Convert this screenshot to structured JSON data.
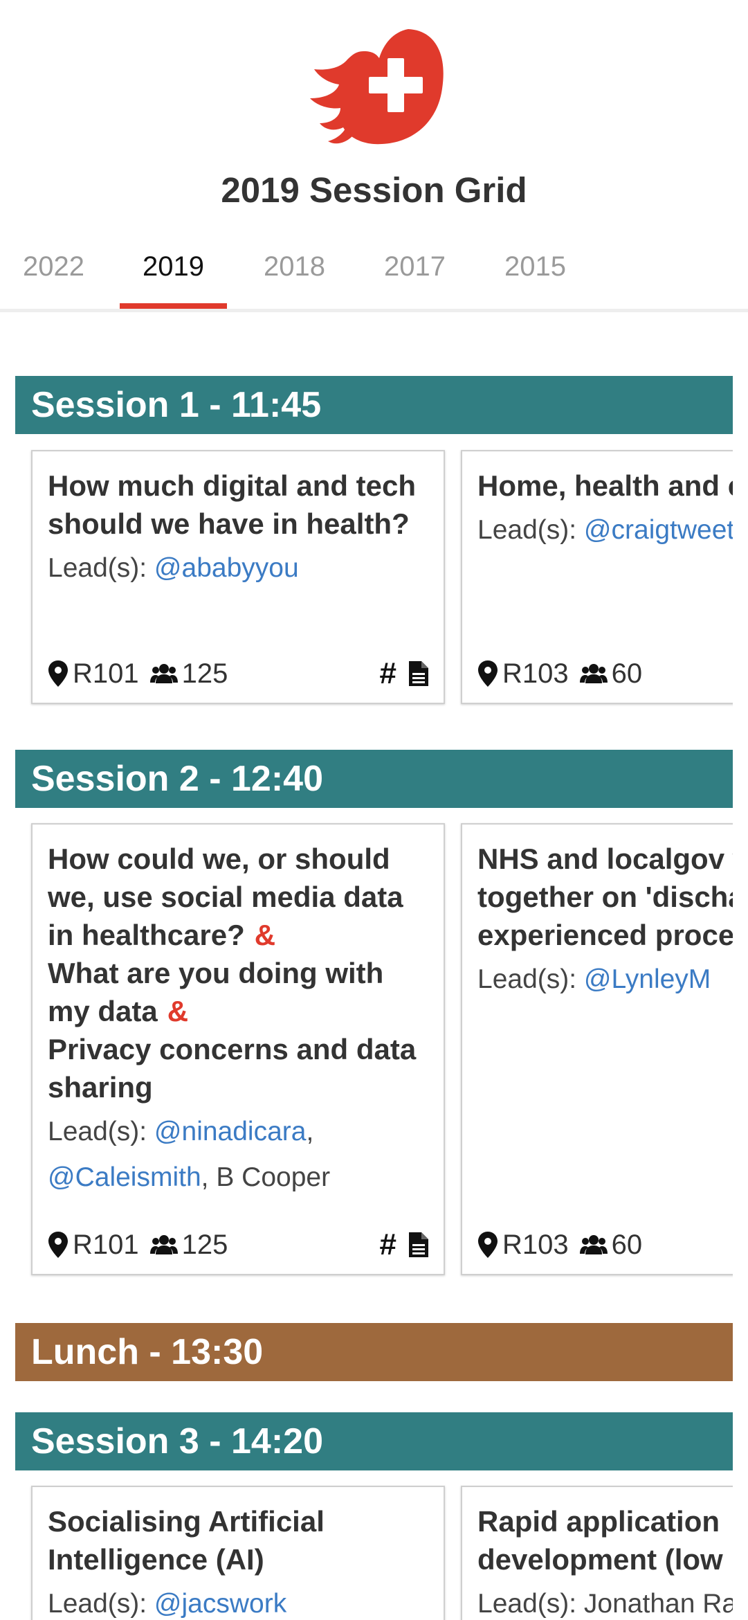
{
  "brand": {
    "logo_icon": "flame-cross-logo",
    "accent": "#e03a2c"
  },
  "page_title": "2019 Session Grid",
  "tabs": [
    {
      "label": "2022",
      "active": false
    },
    {
      "label": "2019",
      "active": true
    },
    {
      "label": "2018",
      "active": false
    },
    {
      "label": "2017",
      "active": false
    },
    {
      "label": "2015",
      "active": false
    }
  ],
  "colors": {
    "session_header": "#317e82",
    "lunch_header": "#9e693d",
    "link": "#3b7bc4"
  },
  "leads_label": "Lead(s):",
  "sessions": [
    {
      "heading": "Session 1 - 11:45",
      "cards": [
        {
          "titles": [
            "How much digital and tech should we have in health?"
          ],
          "leads": [
            {
              "text": "@ababyyou",
              "link": true
            }
          ],
          "room": "R101",
          "count": "125",
          "has_hashtag": true,
          "has_doc": true
        },
        {
          "titles": [
            "Home, health and care"
          ],
          "leads": [
            {
              "text": "@craigtweet",
              "link": true
            }
          ],
          "room": "R103",
          "count": "60",
          "has_hashtag": false,
          "has_doc": false
        }
      ]
    },
    {
      "heading": "Session 2 - 12:40",
      "cards": [
        {
          "titles": [
            "How could we, or should we, use social media data in healthcare?",
            "What are you doing with my data",
            "Privacy concerns and data sharing"
          ],
          "leads": [
            {
              "text": "@ninadicara",
              "link": true
            },
            {
              "text": "@Caleismith",
              "link": true
            },
            {
              "text": "B Cooper",
              "link": false
            }
          ],
          "room": "R101",
          "count": "125",
          "has_hashtag": true,
          "has_doc": true
        },
        {
          "titles": [
            "NHS and localgov working together on 'discharge' as experienced process"
          ],
          "leads": [
            {
              "text": "@LynleyM",
              "link": true
            }
          ],
          "room": "R103",
          "count": "60",
          "has_hashtag": false,
          "has_doc": false
        }
      ]
    },
    {
      "heading": "Lunch - 13:30"
    },
    {
      "heading": "Session 3 - 14:20",
      "cards": [
        {
          "titles": [
            "Socialising Artificial Intelligence (AI)"
          ],
          "leads": [
            {
              "text": "@jacswork",
              "link": true
            }
          ]
        },
        {
          "titles": [
            "Rapid application development (low"
          ],
          "leads": [
            {
              "text": "Jonathan Ra",
              "link": false
            }
          ]
        }
      ]
    }
  ]
}
